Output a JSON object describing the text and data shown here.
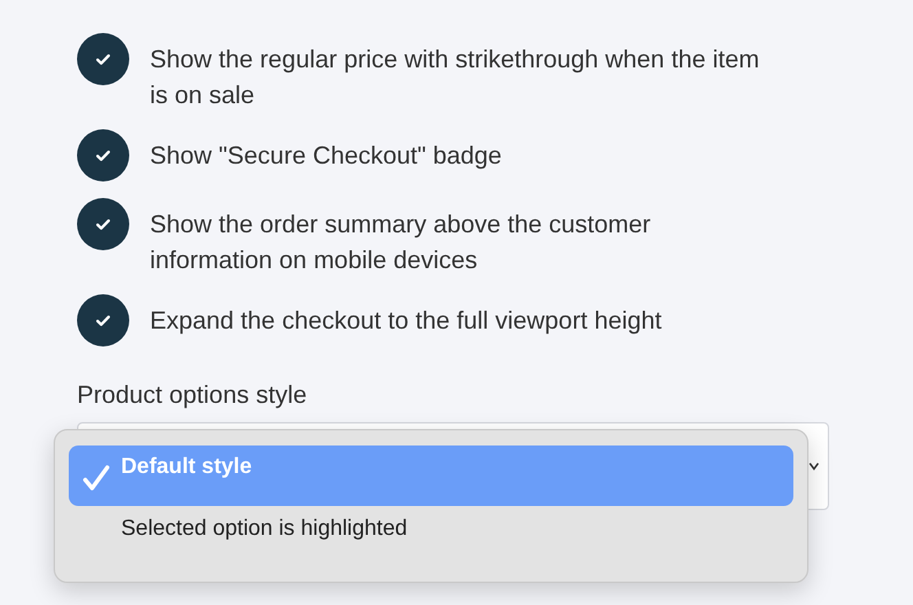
{
  "options": [
    {
      "label": "Show the regular price with strikethrough when the item is on sale",
      "checked": true
    },
    {
      "label": "Show \"Secure Checkout\" badge",
      "checked": true
    },
    {
      "label": "Show the order summary above the customer information on mobile devices",
      "checked": true
    },
    {
      "label": "Expand the checkout to the full viewport height",
      "checked": true
    }
  ],
  "product_options_style": {
    "label": "Product options style",
    "dropdown": [
      {
        "label": "Default style",
        "selected": true
      },
      {
        "label": "Selected option is highlighted",
        "selected": false
      }
    ]
  }
}
